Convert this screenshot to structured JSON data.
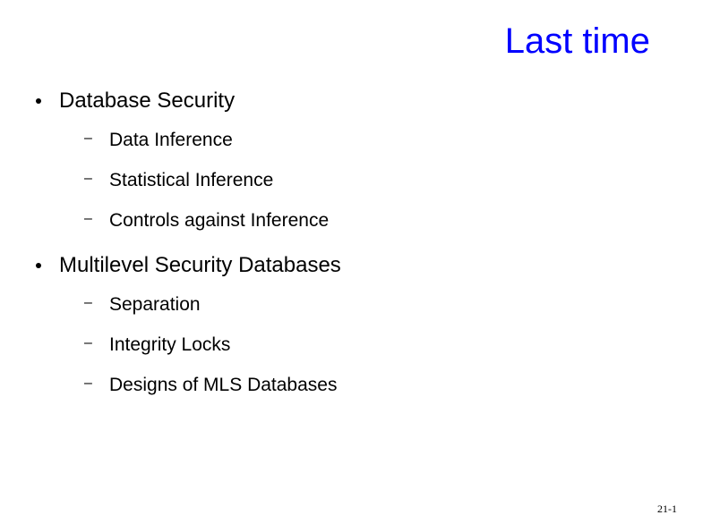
{
  "title": "Last time",
  "items": [
    {
      "label": "Database Security",
      "sub": [
        "Data Inference",
        "Statistical Inference",
        "Controls against Inference"
      ]
    },
    {
      "label": "Multilevel Security Databases",
      "sub": [
        "Separation",
        "Integrity Locks",
        "Designs of MLS Databases"
      ]
    }
  ],
  "page_number": "21-1"
}
